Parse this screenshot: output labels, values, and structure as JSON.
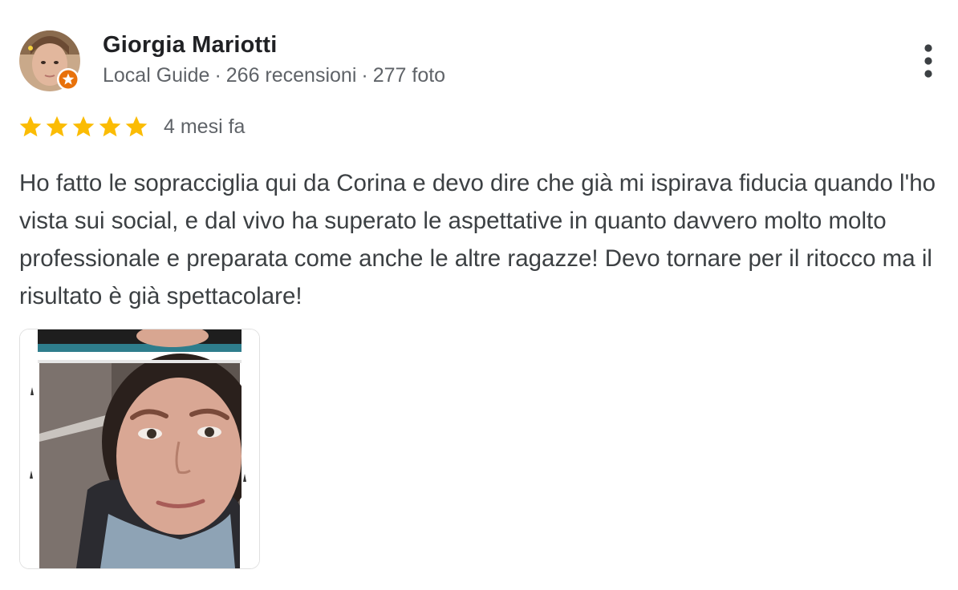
{
  "reviewer": {
    "name": "Giorgia Mariotti",
    "level": "Local Guide",
    "separator": "·",
    "reviews_count": "266 recensioni",
    "photos_count": "277 foto",
    "badge_icon": "local-guide-star-badge",
    "badge_color": "#e8710a"
  },
  "review": {
    "rating": 5,
    "max_rating": 5,
    "star_color": "#fbbc04",
    "date": "4 mesi fa",
    "text": "Ho fatto le sopracciglia qui da Corina e devo dire che già mi ispirava fiducia quando l'ho vista sui social, e dal vivo ha superato le aspettative in quanto davvero molto molto professionale e preparata come anche le altre ragazze! Devo tornare per il ritocco ma il risultato è già spettacolare!"
  },
  "actions": {
    "more_icon": "more-vertical-icon"
  },
  "photos": [
    {
      "alt": "review-photo-selfie-eyebrows"
    }
  ]
}
